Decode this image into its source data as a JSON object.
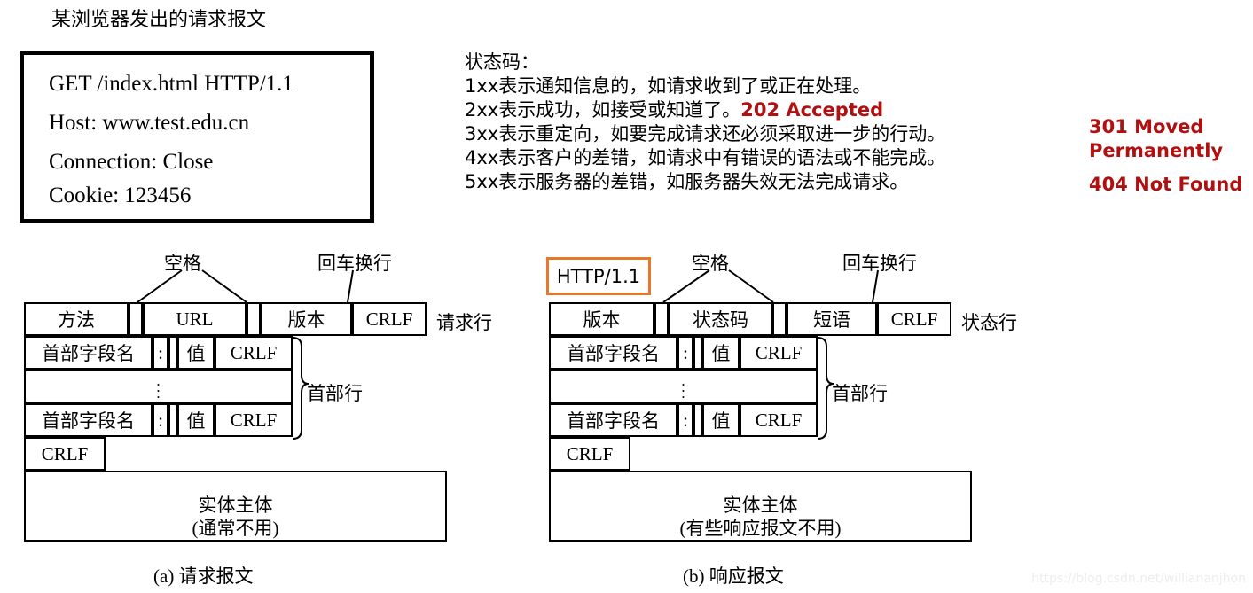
{
  "sample": {
    "title": "某浏览器发出的请求报文",
    "lines": [
      "GET /index.html HTTP/1.1",
      "Host: www.test.edu.cn",
      "Connection: Close",
      "Cookie: 123456"
    ]
  },
  "status_codes": {
    "heading": "状态码：",
    "lines": [
      "1xx表示通知信息的，如请求收到了或正在处理。",
      "2xx表示成功，如接受或知道了。",
      "3xx表示重定向，如要完成请求还必须采取进一步的行动。",
      "4xx表示客户的差错，如请求中有错误的语法或不能完成。",
      "5xx表示服务器的差错，如服务器失效无法完成请求。"
    ],
    "inline_202": "202 Accepted",
    "code_301_line1": "301 Moved",
    "code_301_line2": "Permanently",
    "code_404": "404 Not Found",
    "red_color": "#b01010"
  },
  "request_diagram": {
    "caption": "(a) 请求报文",
    "leader_space": "空格",
    "leader_crlf": "回车换行",
    "row_label": "请求行",
    "header_brace_label": "首部行",
    "first_row": [
      "方法",
      "URL",
      "版本",
      "CRLF"
    ],
    "header_field_name": "首部字段名",
    "colon": ":",
    "value": "值",
    "crlf": "CRLF",
    "blank_crlf": "CRLF",
    "body_title": "实体主体",
    "body_note": "(通常不用)"
  },
  "response_diagram": {
    "caption": "(b) 响应报文",
    "leader_space": "空格",
    "leader_crlf": "回车换行",
    "row_label": "状态行",
    "header_brace_label": "首部行",
    "version_tag": "HTTP/1.1",
    "version_tag_color": "#e8762c",
    "first_row": [
      "版本",
      "状态码",
      "短语",
      "CRLF"
    ],
    "header_field_name": "首部字段名",
    "colon": ":",
    "value": "值",
    "crlf": "CRLF",
    "blank_crlf": "CRLF",
    "body_title": "实体主体",
    "body_note": "(有些响应报文不用)"
  },
  "watermark": "https://blog.csdn.net/williananjhon"
}
